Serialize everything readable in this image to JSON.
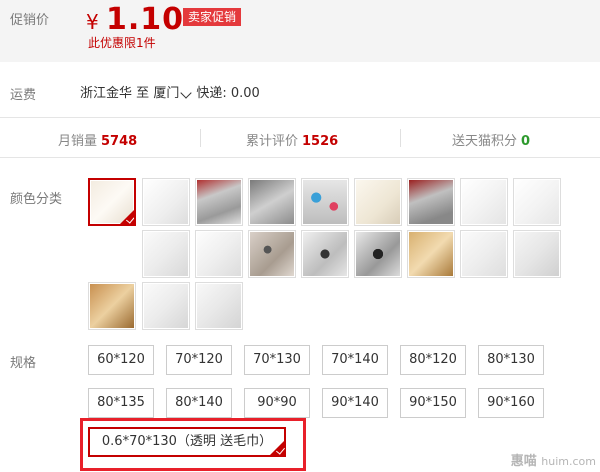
{
  "promo": {
    "label": "促销价",
    "currency": "¥",
    "price": "1.10",
    "badge": "卖家促销",
    "limit": "此优惠限1件"
  },
  "shipping": {
    "label": "运费",
    "origin": "浙江金华",
    "to_word": "至",
    "destination": "厦门",
    "method": "快递: 0.00"
  },
  "stats": [
    {
      "label": "月销量",
      "value": "5748",
      "color": "#c40000"
    },
    {
      "label": "累计评价",
      "value": "1526",
      "color": "#c40000"
    },
    {
      "label": "送天猫积分",
      "value": "0",
      "color": "#2d9a2d"
    }
  ],
  "colors": {
    "label": "颜色分类",
    "swatches": [
      {
        "name": "swatch-1",
        "selected": true
      },
      {
        "name": "swatch-2"
      },
      {
        "name": "swatch-3"
      },
      {
        "name": "swatch-4"
      },
      {
        "name": "swatch-5"
      },
      {
        "name": "swatch-6"
      },
      {
        "name": "swatch-7"
      },
      {
        "name": "swatch-8"
      },
      {
        "name": "swatch-9"
      },
      {
        "name": "swatch-10"
      },
      {
        "name": "swatch-11"
      },
      {
        "name": "swatch-12"
      },
      {
        "name": "swatch-13"
      },
      {
        "name": "swatch-14"
      },
      {
        "name": "swatch-15"
      },
      {
        "name": "swatch-16"
      },
      {
        "name": "swatch-17"
      },
      {
        "name": "swatch-18"
      },
      {
        "name": "swatch-19"
      },
      {
        "name": "swatch-20"
      }
    ]
  },
  "sizes": {
    "label": "规格",
    "options": [
      "60*120",
      "70*120",
      "70*130",
      "70*140",
      "80*120",
      "80*130",
      "80*135",
      "80*140",
      "90*90",
      "90*140",
      "90*150",
      "90*160",
      "0.6*70*130（透明 送毛巾）"
    ],
    "selected_index": 12
  },
  "watermark": {
    "main": "惠喵",
    "sub": "huim.com"
  },
  "accent": "#c40000"
}
